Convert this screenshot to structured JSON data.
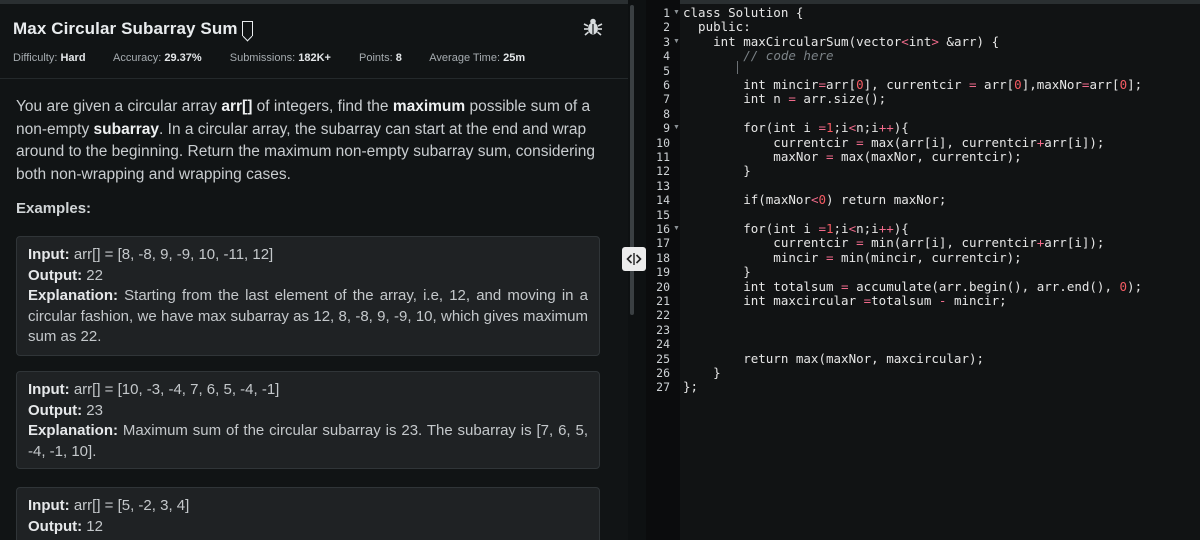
{
  "problem": {
    "title": "Max Circular Subarray Sum",
    "meta": {
      "difficulty_label": "Difficulty:",
      "difficulty_value": "Hard",
      "accuracy_label": "Accuracy:",
      "accuracy_value": "29.37%",
      "submissions_label": "Submissions:",
      "submissions_value": "182K+",
      "points_label": "Points:",
      "points_value": "8",
      "avg_time_label": "Average Time:",
      "avg_time_value": "25m"
    },
    "description": {
      "p1": "You are given a circular array ",
      "b1": "arr[]",
      "p2": " of integers, find the ",
      "b2": "maximum",
      "p3": " possible sum of a non-empty ",
      "b3": "subarray",
      "p4": ". In a circular array, the subarray can start at the end and wrap around to the beginning. Return the maximum non-empty subarray sum, considering both non-wrapping and wrapping cases."
    },
    "examples_label": "Examples:",
    "examples": [
      {
        "input_label": "Input:",
        "input": " arr[] = [8, -8, 9, -9, 10, -11, 12]",
        "output_label": "Output:",
        "output": " 22",
        "explanation_label": "Explanation:",
        "explanation": " Starting from the last element of the array, i.e, 12, and moving in a circular fashion, we have max subarray as 12, 8, -8, 9, -9, 10, which gives maximum sum as 22."
      },
      {
        "input_label": "Input:",
        "input": " arr[] = [10, -3, -4, 7, 6, 5, -4, -1]",
        "output_label": "Output:",
        "output": " 23",
        "explanation_label": "Explanation:",
        "explanation": " Maximum sum of the circular subarray is 23. The subarray is [7, 6, 5, -4, -1, 10]."
      },
      {
        "input_label": "Input:",
        "input": " arr[] = [5, -2, 3, 4]",
        "output_label": "Output:",
        "output": " 12"
      }
    ]
  },
  "editor": {
    "language": "C++",
    "line_numbers": [
      "1",
      "2",
      "3",
      "4",
      "5",
      "6",
      "7",
      "8",
      "9",
      "10",
      "11",
      "12",
      "13",
      "14",
      "15",
      "16",
      "17",
      "18",
      "19",
      "20",
      "21",
      "22",
      "23",
      "24",
      "25",
      "26",
      "27"
    ],
    "lines": [
      "class Solution {",
      "  public:",
      "    int maxCircularSum(vector<int> &arr) {",
      "        // code here",
      "        ",
      "        int mincir=arr[0], currentcir = arr[0],maxNor=arr[0];",
      "        int n = arr.size();",
      "",
      "        for(int i =1;i<n;i++){",
      "            currentcir = max(arr[i], currentcir+arr[i]);",
      "            maxNor = max(maxNor, currentcir);",
      "        }",
      "",
      "        if(maxNor<0) return maxNor;",
      "",
      "        for(int i =1;i<n;i++){",
      "            currentcir = min(arr[i], currentcir+arr[i]);",
      "            mincir = min(mincir, currentcir);",
      "        }",
      "        int totalsum = accumulate(arr.begin(), arr.end(), 0);",
      "        int maxcircular =totalsum - mincir;",
      "",
      "",
      "",
      "        return max(maxNor, maxcircular);",
      "    }",
      "};"
    ],
    "fold_markers": [
      "1",
      "3",
      "9",
      "16"
    ]
  },
  "icons": {
    "bookmark": "bookmark-icon",
    "bug": "bug-icon",
    "splitter": "split-arrows-icon"
  },
  "colors": {
    "accent_red": "#f45b63",
    "comment": "#7b8287"
  }
}
